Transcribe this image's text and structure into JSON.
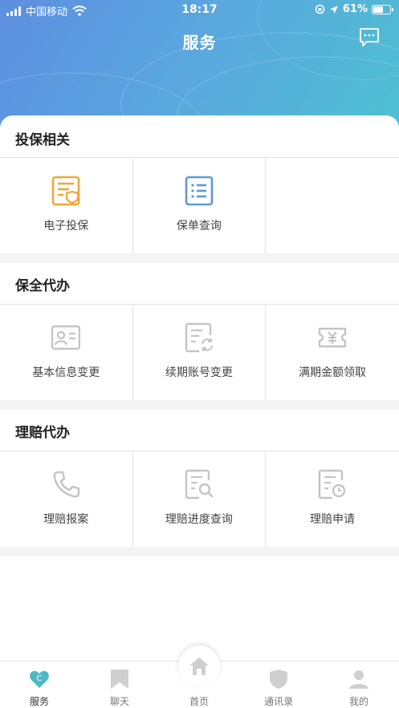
{
  "status_bar": {
    "carrier": "中国移动",
    "time": "18:17",
    "battery": "61%",
    "battery_level": 0.61
  },
  "header": {
    "title": "服务",
    "message_icon": "chat-bubble-icon"
  },
  "sections": [
    {
      "title": "投保相关",
      "items": [
        {
          "label": "电子投保",
          "icon": "document-shield-icon",
          "color": "#f0a63a"
        },
        {
          "label": "保单查询",
          "icon": "document-list-icon",
          "color": "#5b9ad6"
        }
      ]
    },
    {
      "title": "保全代办",
      "items": [
        {
          "label": "基本信息变更",
          "icon": "id-card-icon",
          "color": "#c4c4c4"
        },
        {
          "label": "续期账号变更",
          "icon": "document-refresh-icon",
          "color": "#c4c4c4"
        },
        {
          "label": "满期金额领取",
          "icon": "yen-ticket-icon",
          "color": "#c4c4c4"
        }
      ]
    },
    {
      "title": "理赔代办",
      "items": [
        {
          "label": "理赔报案",
          "icon": "phone-icon",
          "color": "#c4c4c4"
        },
        {
          "label": "理赔进度查询",
          "icon": "document-search-icon",
          "color": "#c4c4c4"
        },
        {
          "label": "理赔申请",
          "icon": "document-clock-icon",
          "color": "#c4c4c4"
        }
      ]
    }
  ],
  "tabbar": {
    "items": [
      {
        "label": "服务",
        "icon": "heart-c-icon"
      },
      {
        "label": "聊天",
        "icon": "bookmark-icon"
      },
      {
        "label": "首页",
        "icon": "home-icon"
      },
      {
        "label": "通讯录",
        "icon": "shield-icon"
      },
      {
        "label": "我的",
        "icon": "person-icon"
      }
    ],
    "home_badge_letter": "C",
    "active_color": "#4fb8c6"
  }
}
